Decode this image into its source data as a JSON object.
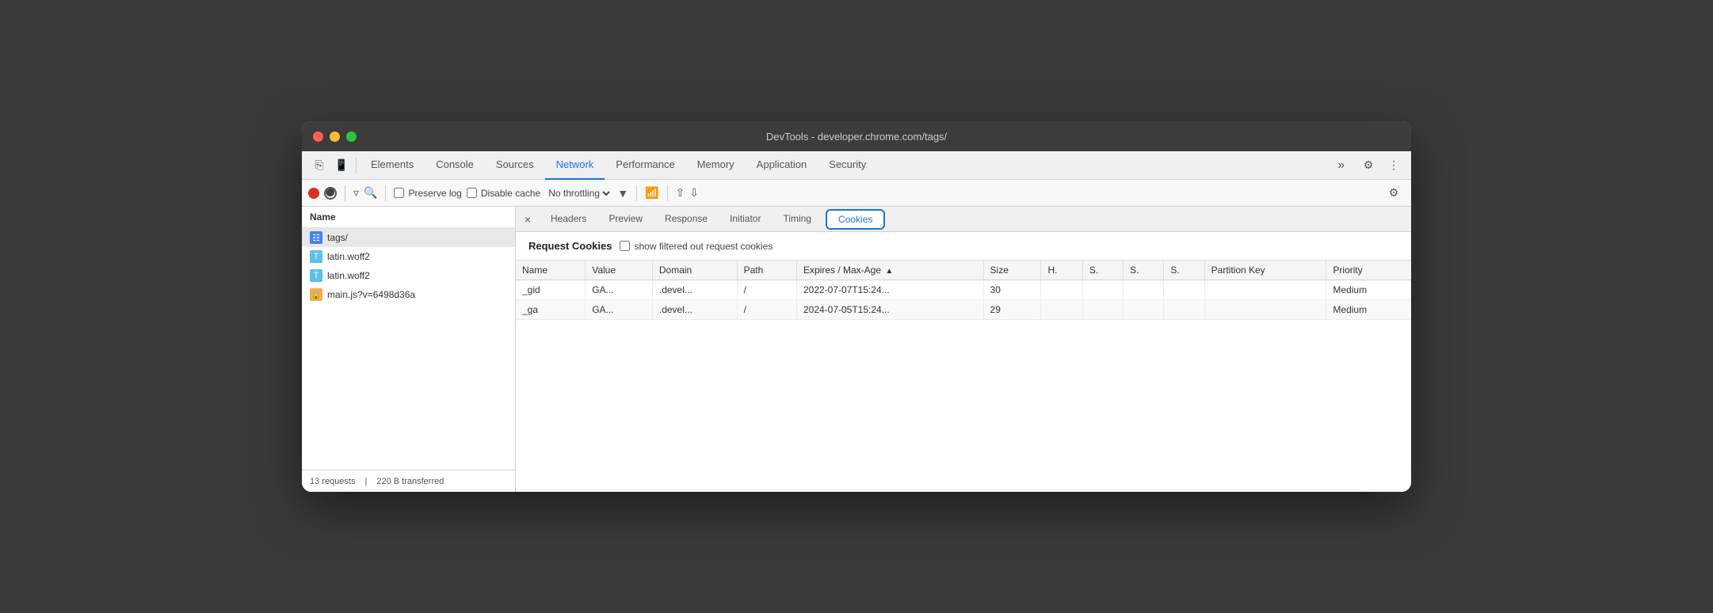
{
  "window": {
    "title": "DevTools - developer.chrome.com/tags/"
  },
  "tabs": {
    "items": [
      {
        "label": "Elements",
        "active": false
      },
      {
        "label": "Console",
        "active": false
      },
      {
        "label": "Sources",
        "active": false
      },
      {
        "label": "Network",
        "active": true
      },
      {
        "label": "Performance",
        "active": false
      },
      {
        "label": "Memory",
        "active": false
      },
      {
        "label": "Application",
        "active": false
      },
      {
        "label": "Security",
        "active": false
      }
    ]
  },
  "network_toolbar": {
    "preserve_log": "Preserve log",
    "disable_cache": "Disable cache",
    "throttling": "No throttling"
  },
  "sidebar": {
    "header": "Name",
    "items": [
      {
        "label": "tags/",
        "icon": "doc",
        "selected": true
      },
      {
        "label": "latin.woff2",
        "icon": "font-blue"
      },
      {
        "label": "latin.woff2",
        "icon": "font-blue"
      },
      {
        "label": "main.js?v=6498d36a",
        "icon": "font-yellow"
      }
    ],
    "status": "13 requests",
    "transferred": "220 B transferred"
  },
  "panel_tabs": {
    "items": [
      {
        "label": "Headers",
        "active": false
      },
      {
        "label": "Preview",
        "active": false
      },
      {
        "label": "Response",
        "active": false
      },
      {
        "label": "Initiator",
        "active": false
      },
      {
        "label": "Timing",
        "active": false
      },
      {
        "label": "Cookies",
        "active": true,
        "highlighted": true
      }
    ]
  },
  "cookies": {
    "title": "Request Cookies",
    "show_filtered_label": "show filtered out request cookies",
    "table": {
      "headers": [
        {
          "label": "Name",
          "sortable": false
        },
        {
          "label": "Value",
          "sortable": false
        },
        {
          "label": "Domain",
          "sortable": false
        },
        {
          "label": "Path",
          "sortable": false
        },
        {
          "label": "Expires / Max-Age",
          "sortable": true,
          "sort": "▲"
        },
        {
          "label": "Size",
          "sortable": false
        },
        {
          "label": "H.",
          "sortable": false
        },
        {
          "label": "S.",
          "sortable": false
        },
        {
          "label": "S.",
          "sortable": false
        },
        {
          "label": "S.",
          "sortable": false
        },
        {
          "label": "Partition Key",
          "sortable": false
        },
        {
          "label": "Priority",
          "sortable": false
        }
      ],
      "rows": [
        {
          "name": "_gid",
          "value": "GA...",
          "domain": ".devel...",
          "path": "/",
          "expires": "2022-07-07T15:24...",
          "size": "30",
          "h": "",
          "s1": "",
          "s2": "",
          "s3": "",
          "partition_key": "",
          "priority": "Medium"
        },
        {
          "name": "_ga",
          "value": "GA...",
          "domain": ".devel...",
          "path": "/",
          "expires": "2024-07-05T15:24...",
          "size": "29",
          "h": "",
          "s1": "",
          "s2": "",
          "s3": "",
          "partition_key": "",
          "priority": "Medium"
        }
      ]
    }
  }
}
